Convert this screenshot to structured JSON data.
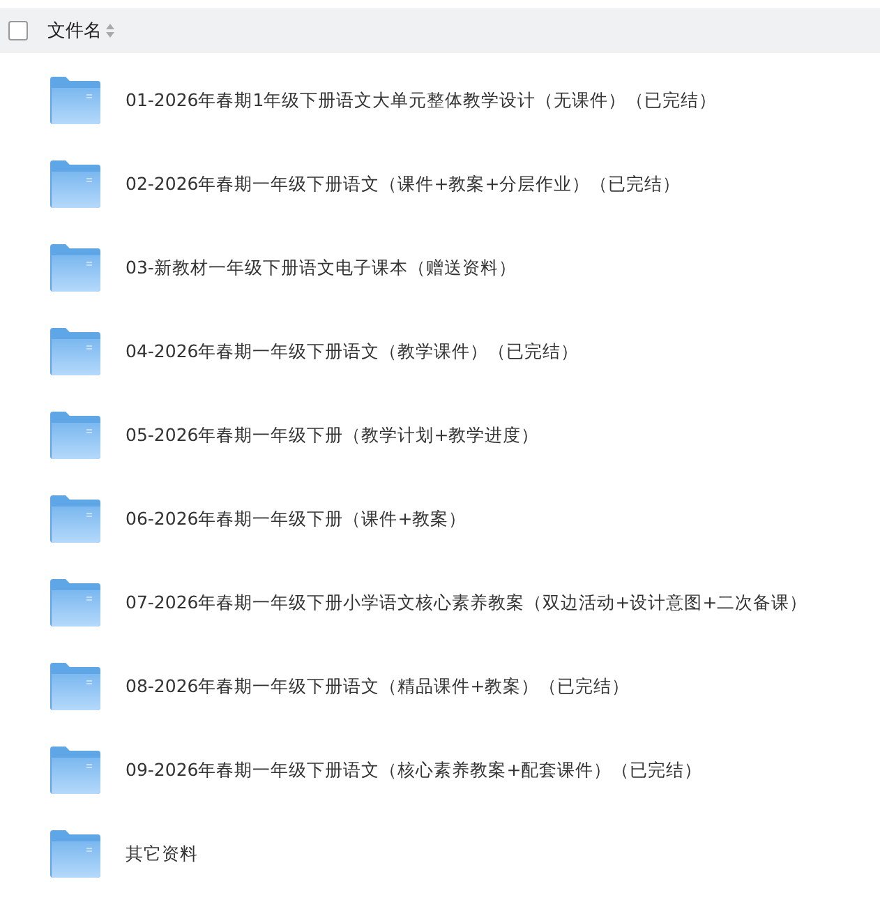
{
  "header": {
    "select_all": {
      "checked": false
    },
    "column": "文件名"
  },
  "files": [
    {
      "name": "01-2026年春期1年级下册语文大单元整体教学设计（无课件）（已完结）"
    },
    {
      "name": "02-2026年春期一年级下册语文（课件+教案+分层作业）（已完结）"
    },
    {
      "name": "03-新教材一年级下册语文电子课本（赠送资料）"
    },
    {
      "name": "04-2026年春期一年级下册语文（教学课件）（已完结）"
    },
    {
      "name": "05-2026年春期一年级下册（教学计划+教学进度）"
    },
    {
      "name": "06-2026年春期一年级下册（课件+教案）"
    },
    {
      "name": "07-2026年春期一年级下册小学语文核心素养教案（双边活动+设计意图+二次备课）"
    },
    {
      "name": "08-2026年春期一年级下册语文（精品课件+教案）（已完结）"
    },
    {
      "name": "09-2026年春期一年级下册语文（核心素养教案+配套课件）（已完结）"
    },
    {
      "name": "其它资料"
    }
  ]
}
